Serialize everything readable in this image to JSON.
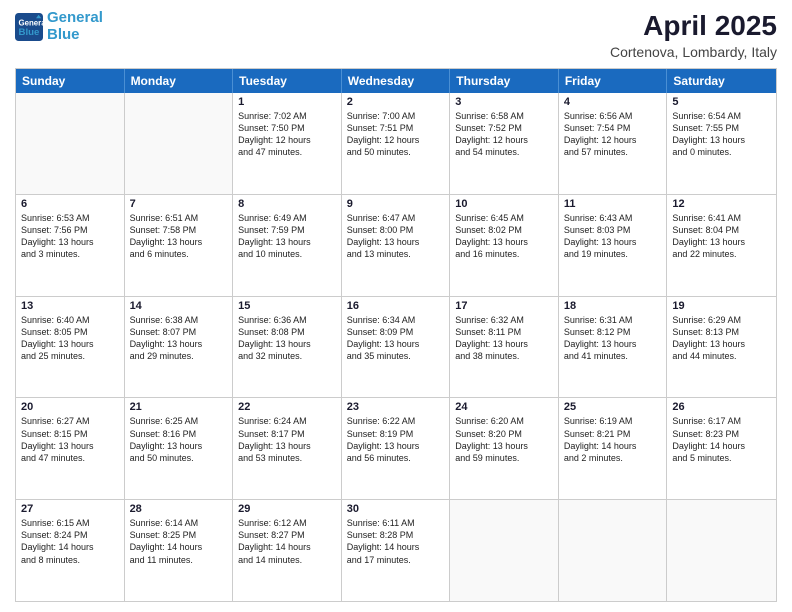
{
  "header": {
    "logo_line1": "General",
    "logo_line2": "Blue",
    "month": "April 2025",
    "location": "Cortenova, Lombardy, Italy"
  },
  "weekdays": [
    "Sunday",
    "Monday",
    "Tuesday",
    "Wednesday",
    "Thursday",
    "Friday",
    "Saturday"
  ],
  "rows": [
    [
      {
        "day": "",
        "text": ""
      },
      {
        "day": "",
        "text": ""
      },
      {
        "day": "1",
        "text": "Sunrise: 7:02 AM\nSunset: 7:50 PM\nDaylight: 12 hours\nand 47 minutes."
      },
      {
        "day": "2",
        "text": "Sunrise: 7:00 AM\nSunset: 7:51 PM\nDaylight: 12 hours\nand 50 minutes."
      },
      {
        "day": "3",
        "text": "Sunrise: 6:58 AM\nSunset: 7:52 PM\nDaylight: 12 hours\nand 54 minutes."
      },
      {
        "day": "4",
        "text": "Sunrise: 6:56 AM\nSunset: 7:54 PM\nDaylight: 12 hours\nand 57 minutes."
      },
      {
        "day": "5",
        "text": "Sunrise: 6:54 AM\nSunset: 7:55 PM\nDaylight: 13 hours\nand 0 minutes."
      }
    ],
    [
      {
        "day": "6",
        "text": "Sunrise: 6:53 AM\nSunset: 7:56 PM\nDaylight: 13 hours\nand 3 minutes."
      },
      {
        "day": "7",
        "text": "Sunrise: 6:51 AM\nSunset: 7:58 PM\nDaylight: 13 hours\nand 6 minutes."
      },
      {
        "day": "8",
        "text": "Sunrise: 6:49 AM\nSunset: 7:59 PM\nDaylight: 13 hours\nand 10 minutes."
      },
      {
        "day": "9",
        "text": "Sunrise: 6:47 AM\nSunset: 8:00 PM\nDaylight: 13 hours\nand 13 minutes."
      },
      {
        "day": "10",
        "text": "Sunrise: 6:45 AM\nSunset: 8:02 PM\nDaylight: 13 hours\nand 16 minutes."
      },
      {
        "day": "11",
        "text": "Sunrise: 6:43 AM\nSunset: 8:03 PM\nDaylight: 13 hours\nand 19 minutes."
      },
      {
        "day": "12",
        "text": "Sunrise: 6:41 AM\nSunset: 8:04 PM\nDaylight: 13 hours\nand 22 minutes."
      }
    ],
    [
      {
        "day": "13",
        "text": "Sunrise: 6:40 AM\nSunset: 8:05 PM\nDaylight: 13 hours\nand 25 minutes."
      },
      {
        "day": "14",
        "text": "Sunrise: 6:38 AM\nSunset: 8:07 PM\nDaylight: 13 hours\nand 29 minutes."
      },
      {
        "day": "15",
        "text": "Sunrise: 6:36 AM\nSunset: 8:08 PM\nDaylight: 13 hours\nand 32 minutes."
      },
      {
        "day": "16",
        "text": "Sunrise: 6:34 AM\nSunset: 8:09 PM\nDaylight: 13 hours\nand 35 minutes."
      },
      {
        "day": "17",
        "text": "Sunrise: 6:32 AM\nSunset: 8:11 PM\nDaylight: 13 hours\nand 38 minutes."
      },
      {
        "day": "18",
        "text": "Sunrise: 6:31 AM\nSunset: 8:12 PM\nDaylight: 13 hours\nand 41 minutes."
      },
      {
        "day": "19",
        "text": "Sunrise: 6:29 AM\nSunset: 8:13 PM\nDaylight: 13 hours\nand 44 minutes."
      }
    ],
    [
      {
        "day": "20",
        "text": "Sunrise: 6:27 AM\nSunset: 8:15 PM\nDaylight: 13 hours\nand 47 minutes."
      },
      {
        "day": "21",
        "text": "Sunrise: 6:25 AM\nSunset: 8:16 PM\nDaylight: 13 hours\nand 50 minutes."
      },
      {
        "day": "22",
        "text": "Sunrise: 6:24 AM\nSunset: 8:17 PM\nDaylight: 13 hours\nand 53 minutes."
      },
      {
        "day": "23",
        "text": "Sunrise: 6:22 AM\nSunset: 8:19 PM\nDaylight: 13 hours\nand 56 minutes."
      },
      {
        "day": "24",
        "text": "Sunrise: 6:20 AM\nSunset: 8:20 PM\nDaylight: 13 hours\nand 59 minutes."
      },
      {
        "day": "25",
        "text": "Sunrise: 6:19 AM\nSunset: 8:21 PM\nDaylight: 14 hours\nand 2 minutes."
      },
      {
        "day": "26",
        "text": "Sunrise: 6:17 AM\nSunset: 8:23 PM\nDaylight: 14 hours\nand 5 minutes."
      }
    ],
    [
      {
        "day": "27",
        "text": "Sunrise: 6:15 AM\nSunset: 8:24 PM\nDaylight: 14 hours\nand 8 minutes."
      },
      {
        "day": "28",
        "text": "Sunrise: 6:14 AM\nSunset: 8:25 PM\nDaylight: 14 hours\nand 11 minutes."
      },
      {
        "day": "29",
        "text": "Sunrise: 6:12 AM\nSunset: 8:27 PM\nDaylight: 14 hours\nand 14 minutes."
      },
      {
        "day": "30",
        "text": "Sunrise: 6:11 AM\nSunset: 8:28 PM\nDaylight: 14 hours\nand 17 minutes."
      },
      {
        "day": "",
        "text": ""
      },
      {
        "day": "",
        "text": ""
      },
      {
        "day": "",
        "text": ""
      }
    ]
  ]
}
